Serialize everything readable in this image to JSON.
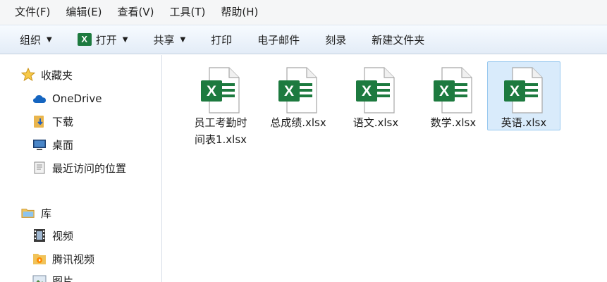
{
  "menubar": {
    "items": [
      "文件(F)",
      "编辑(E)",
      "查看(V)",
      "工具(T)",
      "帮助(H)"
    ]
  },
  "toolbar": {
    "organize": "组织",
    "open": "打开",
    "share": "共享",
    "print": "打印",
    "email": "电子邮件",
    "burn": "刻录",
    "new_folder": "新建文件夹"
  },
  "nav": {
    "favorites": "收藏夹",
    "onedrive": "OneDrive",
    "downloads": "下载",
    "desktop": "桌面",
    "recent": "最近访问的位置",
    "libraries": "库",
    "videos": "视频",
    "tencent_video": "腾讯视频",
    "pictures": "图片"
  },
  "files": [
    {
      "name_line1": "员工考勤时",
      "name_line2": "间表1.xlsx",
      "icon": "excel-file-icon",
      "selected": false
    },
    {
      "name_line1": "总成绩.xlsx",
      "name_line2": "",
      "icon": "excel-file-icon",
      "selected": false
    },
    {
      "name_line1": "语文.xlsx",
      "name_line2": "",
      "icon": "excel-file-icon",
      "selected": false
    },
    {
      "name_line1": "数学.xlsx",
      "name_line2": "",
      "icon": "excel-file-icon",
      "selected": false
    },
    {
      "name_line1": "英语.xlsx",
      "name_line2": "",
      "icon": "excel-file-icon",
      "selected": true
    }
  ],
  "colors": {
    "excel_green": "#1d7a3f",
    "selection_bg": "#d9ebfb",
    "selection_border": "#99c9ef"
  }
}
